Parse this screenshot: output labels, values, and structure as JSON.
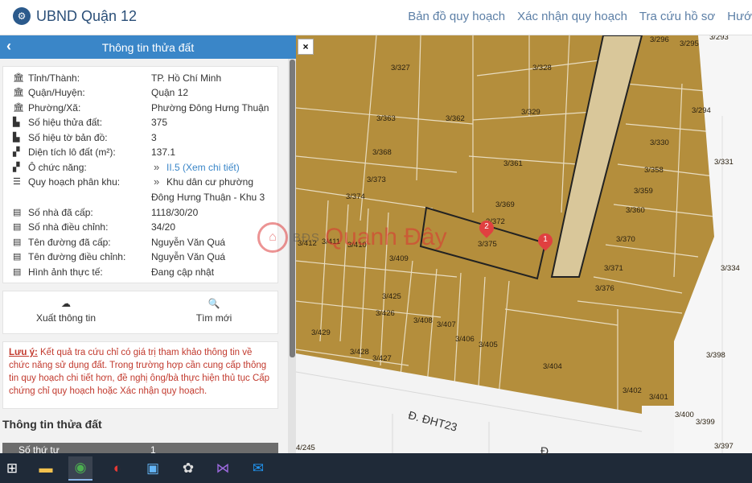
{
  "header": {
    "title": "UBND Quận 12",
    "nav": [
      "Bản đồ quy hoạch",
      "Xác nhận quy hoạch",
      "Tra cứu hồ sơ",
      "Hướ"
    ]
  },
  "panel": {
    "title": "Thông tin thửa đất",
    "rows": [
      {
        "icon": "bank-icon",
        "label": "Tỉnh/Thành:",
        "value": "TP. Hồ Chí Minh"
      },
      {
        "icon": "bank-icon",
        "label": "Quận/Huyện:",
        "value": "Quận 12"
      },
      {
        "icon": "bank-icon",
        "label": "Phường/Xã:",
        "value": "Phường Đông Hưng Thuận"
      },
      {
        "icon": "map-icon",
        "label": "Số hiệu thửa đất:",
        "value": "375"
      },
      {
        "icon": "map-icon",
        "label": "Số hiệu tờ bản đồ:",
        "value": "3"
      },
      {
        "icon": "area-icon",
        "label": "Diện tích lô đất (m²):",
        "value": "137.1"
      },
      {
        "icon": "area-icon",
        "label": "Ô chức năng:",
        "value": "II.5 (Xem chi tiết)"
      },
      {
        "icon": "list-icon",
        "label": "Quy hoạch phân khu:",
        "value": "Khu dân cư phường",
        "value2": "Đông Hưng Thuận - Khu 3"
      },
      {
        "icon": "card-icon",
        "label": "Số nhà đã cấp:",
        "value": "1118/30/20"
      },
      {
        "icon": "card-icon",
        "label": "Số nhà điều chỉnh:",
        "value": "34/20"
      },
      {
        "icon": "card-icon",
        "label": "Tên đường đã cấp:",
        "value": "Nguyễn Văn Quá"
      },
      {
        "icon": "card-icon",
        "label": "Tên đường điều chỉnh:",
        "value": "Nguyễn Văn Quá"
      },
      {
        "icon": "card-icon",
        "label": "Hình ảnh thực tế:",
        "value": "Đang cập nhật"
      }
    ],
    "actions": {
      "export_label": "Xuất thông tin",
      "search_label": "Tìm mới"
    },
    "note": {
      "lead": "Lưu ý:",
      "text": " Kết quả tra cứu chỉ có giá trị tham khảo thông tin về chức năng sử dụng đất. Trong trường hợp cần cung cấp thông tin quy hoạch chi tiết hơn, đề nghị ông/bà thực hiện thủ tục Cấp chứng chỉ quy hoạch hoặc Xác nhận quy hoạch."
    },
    "section_title": "Thông tin thửa đất",
    "table_row": {
      "label": "Số thứ tự",
      "value": "1"
    }
  },
  "map": {
    "close_label": "×",
    "street_1": "Đ. ĐHT23",
    "street_2": "Đ",
    "watermark_1": "BĐS",
    "watermark_2": "Quanh Đây",
    "pin_1": "1",
    "pin_2": "2",
    "plots": [
      "3/296",
      "3/295",
      "3/293",
      "3/327",
      "3/328",
      "3/363",
      "3/362",
      "3/329",
      "3/294",
      "3/368",
      "3/361",
      "3/330",
      "3/331",
      "3/358",
      "3/373",
      "3/374",
      "3/369",
      "3/359",
      "3/372",
      "3/360",
      "3/412",
      "3/411",
      "3/410",
      "3/375",
      "3/370",
      "3/409",
      "3/371",
      "3/334",
      "3/376",
      "3/425",
      "3/426",
      "3/408",
      "3/407",
      "3/429",
      "3/406",
      "3/405",
      "3/428",
      "3/427",
      "3/404",
      "3/398",
      "3/402",
      "3/401",
      "3/400",
      "3/399",
      "3/397",
      "4/245"
    ]
  },
  "taskbar": {
    "icons": [
      "windows-icon",
      "file-explorer-icon",
      "chrome-icon",
      "app-icon",
      "monitor-icon",
      "paint-icon",
      "visual-studio-icon",
      "outlook-icon"
    ]
  }
}
